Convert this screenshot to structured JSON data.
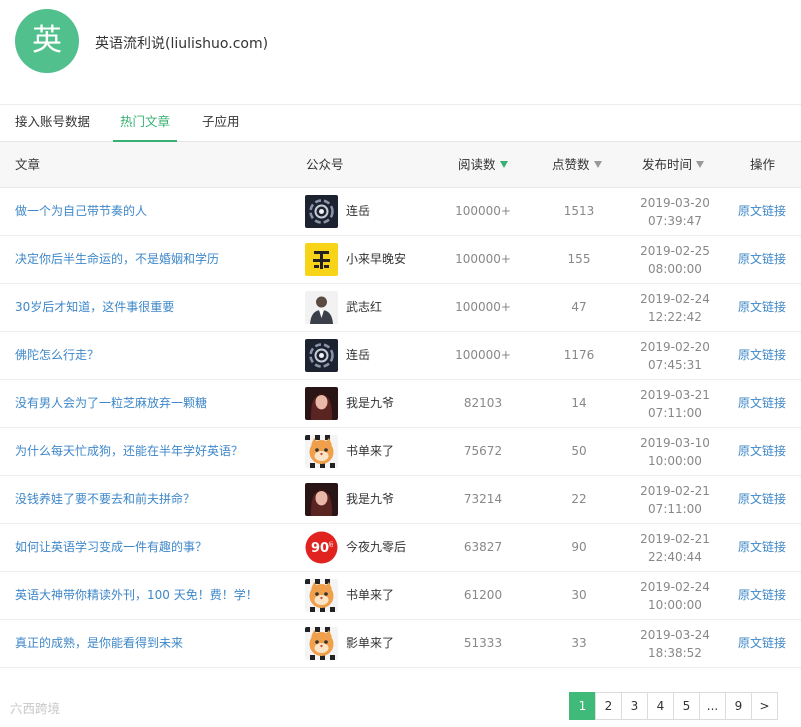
{
  "app": {
    "logo_char": "英",
    "name": "英语流利说(liulishuo.com)"
  },
  "tabs": [
    {
      "label": "接入账号数据",
      "active": false
    },
    {
      "label": "热门文章",
      "active": true
    },
    {
      "label": "子应用",
      "active": false
    }
  ],
  "columns": {
    "article": "文章",
    "account": "公众号",
    "reads": "阅读数",
    "likes": "点赞数",
    "published": "发布时间",
    "action": "操作"
  },
  "link_label": "原文链接",
  "rows": [
    {
      "title": "做一个为自己带节奏的人",
      "account": "连岳",
      "avatar": "galaxy-avatar",
      "reads": "100000+",
      "likes": "1513",
      "date": "2019-03-20",
      "time": "07:39:47"
    },
    {
      "title": "决定你后半生命运的，不是婚姻和学历",
      "account": "小来早晚安",
      "avatar": "yellow-logo-avatar",
      "reads": "100000+",
      "likes": "155",
      "date": "2019-02-25",
      "time": "08:00:00"
    },
    {
      "title": "30岁后才知道，这件事很重要",
      "account": "武志红",
      "avatar": "portrait-avatar",
      "reads": "100000+",
      "likes": "47",
      "date": "2019-02-24",
      "time": "12:22:42"
    },
    {
      "title": "佛陀怎么行走？",
      "account": "连岳",
      "avatar": "galaxy-avatar",
      "reads": "100000+",
      "likes": "1176",
      "date": "2019-02-20",
      "time": "07:45:31"
    },
    {
      "title": "没有男人会为了一粒芝麻放弃一颗糖",
      "account": "我是九爷",
      "avatar": "woman-avatar",
      "reads": "82103",
      "likes": "14",
      "date": "2019-03-21",
      "time": "07:11:00"
    },
    {
      "title": "为什么每天忙成狗，还能在半年学好英语？",
      "account": "书单来了",
      "avatar": "cat-avatar",
      "reads": "75672",
      "likes": "50",
      "date": "2019-03-10",
      "time": "10:00:00"
    },
    {
      "title": "没钱养娃了要不要去和前夫拼命？",
      "account": "我是九爷",
      "avatar": "woman-avatar",
      "reads": "73214",
      "likes": "22",
      "date": "2019-02-21",
      "time": "07:11:00"
    },
    {
      "title": "如何让英语学习变成一件有趣的事？",
      "account": "今夜九零后",
      "avatar": "red-90-avatar",
      "reads": "63827",
      "likes": "90",
      "date": "2019-02-21",
      "time": "22:40:44"
    },
    {
      "title": "英语大神带你精读外刊，100 天免！费！学！",
      "account": "书单来了",
      "avatar": "cat-avatar",
      "reads": "61200",
      "likes": "30",
      "date": "2019-02-24",
      "time": "10:00:00"
    },
    {
      "title": "真正的成熟，是你能看得到未来",
      "account": "影单来了",
      "avatar": "cat-avatar",
      "reads": "51333",
      "likes": "33",
      "date": "2019-03-24",
      "time": "18:38:52"
    }
  ],
  "pagination": [
    "1",
    "2",
    "3",
    "4",
    "5",
    "...",
    "9",
    ">"
  ],
  "pagination_active": "1",
  "watermark": "六西跨境",
  "colors": {
    "accent": "#37b072",
    "link": "#3e87c9",
    "logo_bg": "#52c08c"
  }
}
